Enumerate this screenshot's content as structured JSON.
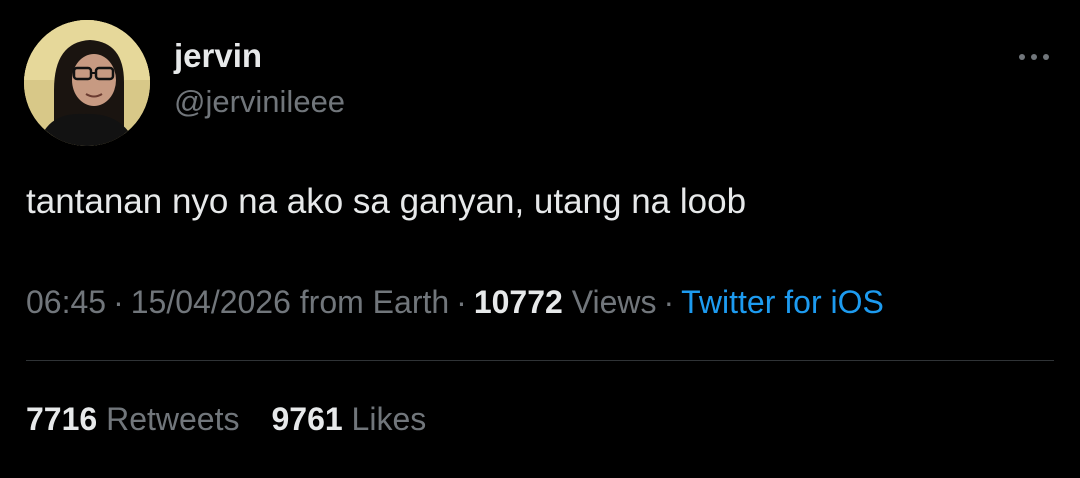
{
  "author": {
    "display_name": "jervin",
    "handle": "@jervinileee"
  },
  "tweet": {
    "text": "tantanan nyo na ako sa ganyan, utang na loob",
    "time": "06:45",
    "date": "15/04/2026",
    "location": "from Earth",
    "views_count": "10772",
    "views_label": "Views",
    "source": "Twitter for iOS",
    "separator": "·"
  },
  "stats": {
    "retweets_count": "7716",
    "retweets_label": "Retweets",
    "likes_count": "9761",
    "likes_label": "Likes"
  },
  "icons": {
    "more": "more-horizontal-icon"
  },
  "colors": {
    "background": "#000000",
    "primary_text": "#e7e9ea",
    "secondary_text": "#71767b",
    "link": "#1d9bf0",
    "divider": "#2f3336"
  }
}
